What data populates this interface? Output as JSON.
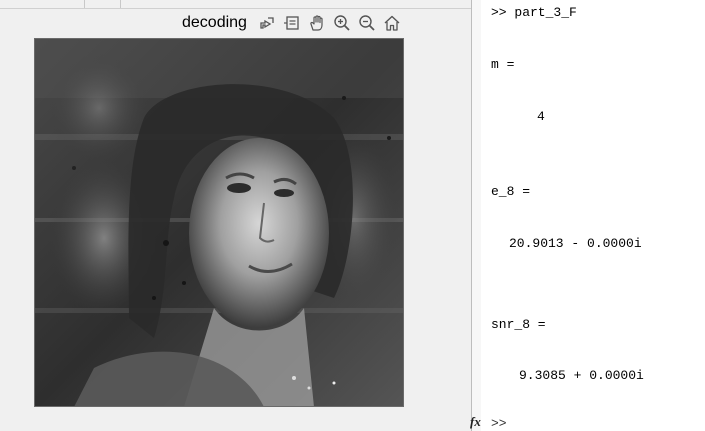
{
  "figure": {
    "title": "decoding",
    "toolbar": {
      "buttons": [
        {
          "name": "export-icon"
        },
        {
          "name": "data-tips-icon"
        },
        {
          "name": "pan-icon"
        },
        {
          "name": "zoom-in-icon"
        },
        {
          "name": "zoom-out-icon"
        },
        {
          "name": "home-icon"
        }
      ]
    }
  },
  "command_window": {
    "command": ">> part_3_F",
    "m_label": "m =",
    "m_value": "4",
    "e8_label": "e_8 =",
    "e8_value": "20.9013 - 0.0000i",
    "snr8_label": "snr_8 =",
    "snr8_value": "9.3085 + 0.0000i",
    "fx_symbol": "fx",
    "prompt": ">>"
  },
  "colors": {
    "figure_bg": "#f0f0f0",
    "image_dark": "#2b2b2b",
    "image_light": "#d8d8d8"
  }
}
